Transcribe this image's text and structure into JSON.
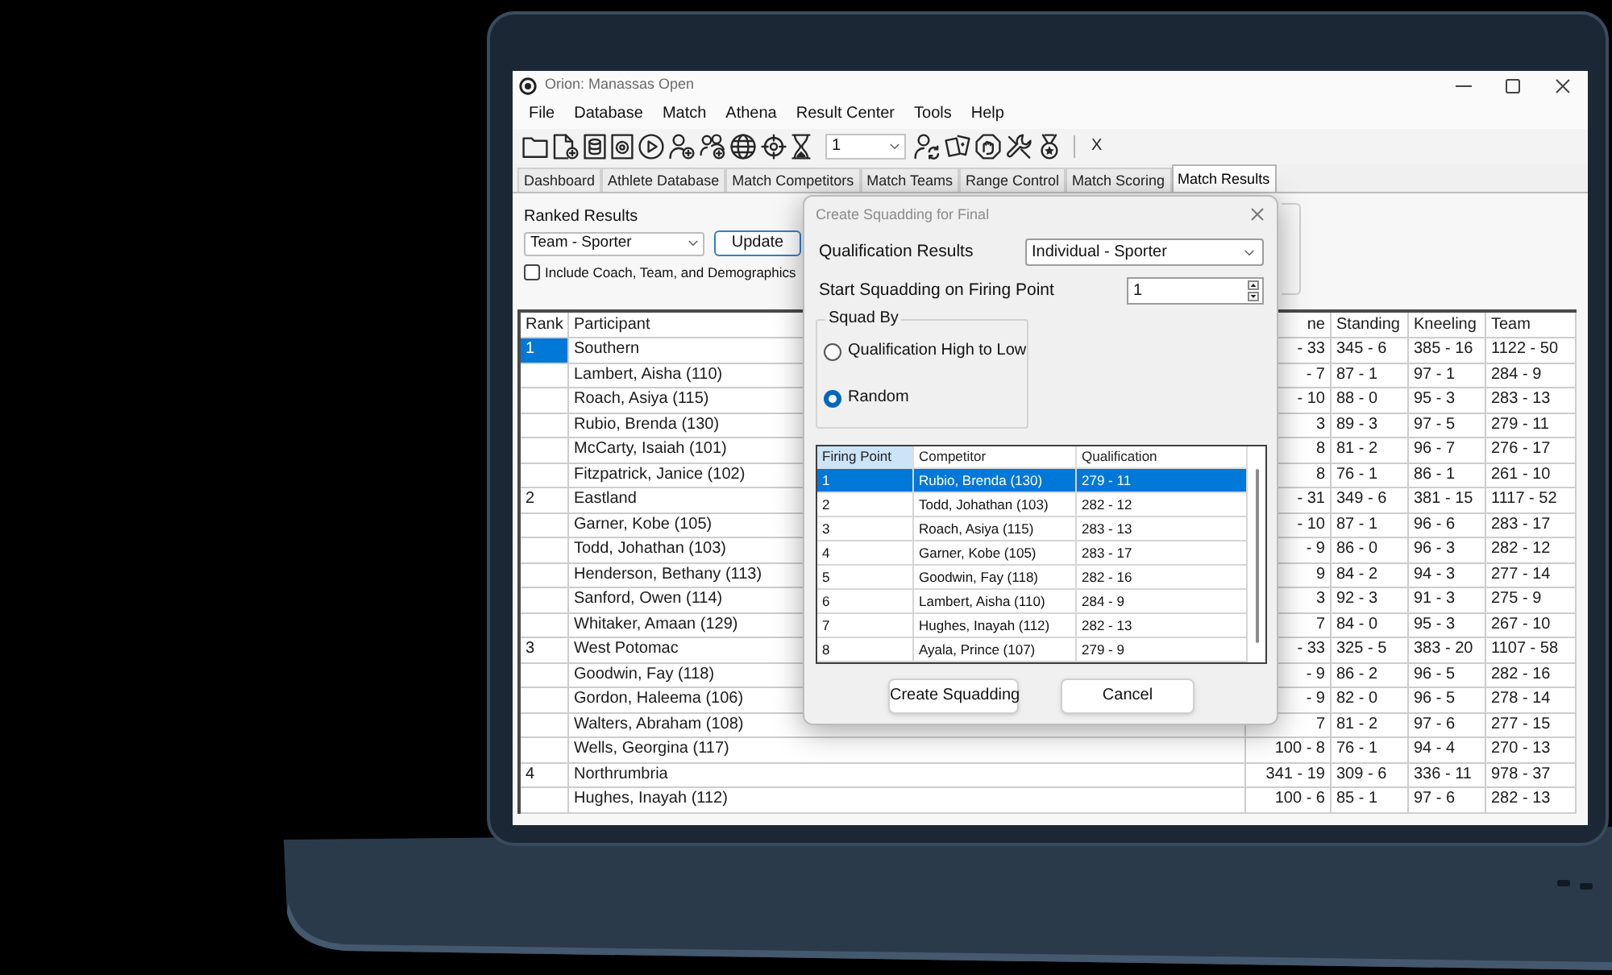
{
  "window": {
    "title": "Orion: Manassas Open"
  },
  "menu": [
    "File",
    "Database",
    "Match",
    "Athena",
    "Result Center",
    "Tools",
    "Help"
  ],
  "toolbar": {
    "dropdown_value": "1",
    "button_text": "X"
  },
  "tabs": [
    {
      "label": "Dashboard",
      "selected": false
    },
    {
      "label": "Athlete Database",
      "selected": false
    },
    {
      "label": "Match Competitors",
      "selected": false
    },
    {
      "label": "Match Teams",
      "selected": false
    },
    {
      "label": "Range Control",
      "selected": false
    },
    {
      "label": "Match Scoring",
      "selected": false
    },
    {
      "label": "Match Results",
      "selected": true
    }
  ],
  "results_panel": {
    "label": "Ranked Results",
    "dropdown_value": "Team - Sporter",
    "button": "Update",
    "checkbox": {
      "label": "Include Coach, Team, and Demographics",
      "checked": false
    }
  },
  "table": {
    "columns": [
      "Rank",
      "Participant",
      "ne",
      "Standing",
      "Kneeling",
      "Team"
    ],
    "rows": [
      {
        "rank": "1",
        "participant": "Southern",
        "column_3": "- 33",
        "standing": "345 - 6",
        "kneeling": "385 - 16",
        "team": "1122 - 50",
        "selected": true
      },
      {
        "participant": "Lambert, Aisha (110)",
        "column_3": "- 7",
        "standing": "87 - 1",
        "kneeling": "97 - 1",
        "team": "284 - 9",
        "selected": false
      },
      {
        "participant": "Roach, Asiya (115)",
        "column_3": "- 10",
        "standing": "88 - 0",
        "kneeling": "95 - 3",
        "team": "283 - 13",
        "selected": false
      },
      {
        "participant": "Rubio, Brenda (130)",
        "column_3": "3",
        "standing": "89 - 3",
        "kneeling": "97 - 5",
        "team": "279 - 11",
        "selected": false
      },
      {
        "participant": "McCarty, Isaiah (101)",
        "column_3": "8",
        "standing": "81 - 2",
        "kneeling": "96 - 7",
        "team": "276 - 17",
        "selected": false
      },
      {
        "participant": "Fitzpatrick, Janice (102)",
        "column_3": "8",
        "standing": "76 - 1",
        "kneeling": "86 - 1",
        "team": "261 - 10",
        "selected": false
      },
      {
        "rank": "2",
        "participant": "Eastland",
        "column_3": "- 31",
        "standing": "349 - 6",
        "kneeling": "381 - 15",
        "team": "1117 - 52",
        "selected": false
      },
      {
        "participant": "Garner, Kobe (105)",
        "column_3": "- 10",
        "standing": "87 - 1",
        "kneeling": "96 - 6",
        "team": "283 - 17",
        "selected": false
      },
      {
        "participant": "Todd, Johathan (103)",
        "column_3": "- 9",
        "standing": "86 - 0",
        "kneeling": "96 - 3",
        "team": "282 - 12",
        "selected": false
      },
      {
        "participant": "Henderson, Bethany (113)",
        "column_3": "9",
        "standing": "84 - 2",
        "kneeling": "94 - 3",
        "team": "277 - 14",
        "selected": false
      },
      {
        "participant": "Sanford, Owen (114)",
        "column_3": "3",
        "standing": "92 - 3",
        "kneeling": "91 - 3",
        "team": "275 - 9",
        "selected": false
      },
      {
        "participant": "Whitaker, Amaan (129)",
        "column_3": "7",
        "standing": "84 - 0",
        "kneeling": "95 - 3",
        "team": "267 - 10",
        "selected": false
      },
      {
        "rank": "3",
        "participant": "West Potomac",
        "column_3": "- 33",
        "standing": "325 - 5",
        "kneeling": "383 - 20",
        "team": "1107 - 58",
        "selected": false
      },
      {
        "participant": "Goodwin, Fay (118)",
        "column_3": "- 9",
        "standing": "86 - 2",
        "kneeling": "96 - 5",
        "team": "282 - 16",
        "selected": false
      },
      {
        "participant": "Gordon, Haleema (106)",
        "column_3": "- 9",
        "standing": "82 - 0",
        "kneeling": "96 - 5",
        "team": "278 - 14",
        "selected": false
      },
      {
        "participant": "Walters, Abraham (108)",
        "column_3": "7",
        "standing": "81 - 2",
        "kneeling": "97 - 6",
        "team": "277 - 15",
        "selected": false
      },
      {
        "participant": "Wells, Georgina (117)",
        "column_3": "100 - 8",
        "standing": "76 - 1",
        "kneeling": "94 - 4",
        "team": "270 - 13",
        "selected": false
      },
      {
        "rank": "4",
        "participant": "Northrumbria",
        "column_3": "341 - 19",
        "standing": "309 - 6",
        "kneeling": "336 - 11",
        "team": "978 - 37",
        "selected": false
      },
      {
        "participant": "Hughes, Inayah (112)",
        "column_3": "100 - 6",
        "standing": "85 - 1",
        "kneeling": "97 - 6",
        "team": "282 - 13",
        "selected": false
      }
    ]
  },
  "dialog": {
    "title": "Create Squadding for Final",
    "qualification": {
      "label": "Qualification Results",
      "value": "Individual - Sporter"
    },
    "start_point": {
      "label": "Start Squadding on Firing Point",
      "value": "1"
    },
    "squad_by": {
      "label": "Squad By",
      "options": [
        {
          "label": "Qualification High to Low",
          "selected": false
        },
        {
          "label": "Random",
          "selected": true
        }
      ]
    },
    "list": {
      "columns": [
        {
          "label": "Firing Point",
          "selected": true
        },
        {
          "label": "Competitor",
          "selected": false
        },
        {
          "label": "Qualification",
          "selected": false
        }
      ],
      "rows": [
        {
          "firing_point": "1",
          "competitor": "Rubio, Brenda (130)",
          "qualification": "279 - 11",
          "selected": true
        },
        {
          "firing_point": "2",
          "competitor": "Todd, Johathan (103)",
          "qualification": "282 - 12",
          "selected": false
        },
        {
          "firing_point": "3",
          "competitor": "Roach, Asiya (115)",
          "qualification": "283 - 13",
          "selected": false
        },
        {
          "firing_point": "4",
          "competitor": "Garner, Kobe (105)",
          "qualification": "283 - 17",
          "selected": false
        },
        {
          "firing_point": "5",
          "competitor": "Goodwin, Fay (118)",
          "qualification": "282 - 16",
          "selected": false
        },
        {
          "firing_point": "6",
          "competitor": "Lambert, Aisha (110)",
          "qualification": "284 - 9",
          "selected": false
        },
        {
          "firing_point": "7",
          "competitor": "Hughes, Inayah (112)",
          "qualification": "282 - 13",
          "selected": false
        },
        {
          "firing_point": "8",
          "competitor": "Ayala, Prince (107)",
          "qualification": "279 - 9",
          "selected": false
        }
      ]
    },
    "buttons": [
      "Create Squadding",
      "Cancel"
    ]
  }
}
